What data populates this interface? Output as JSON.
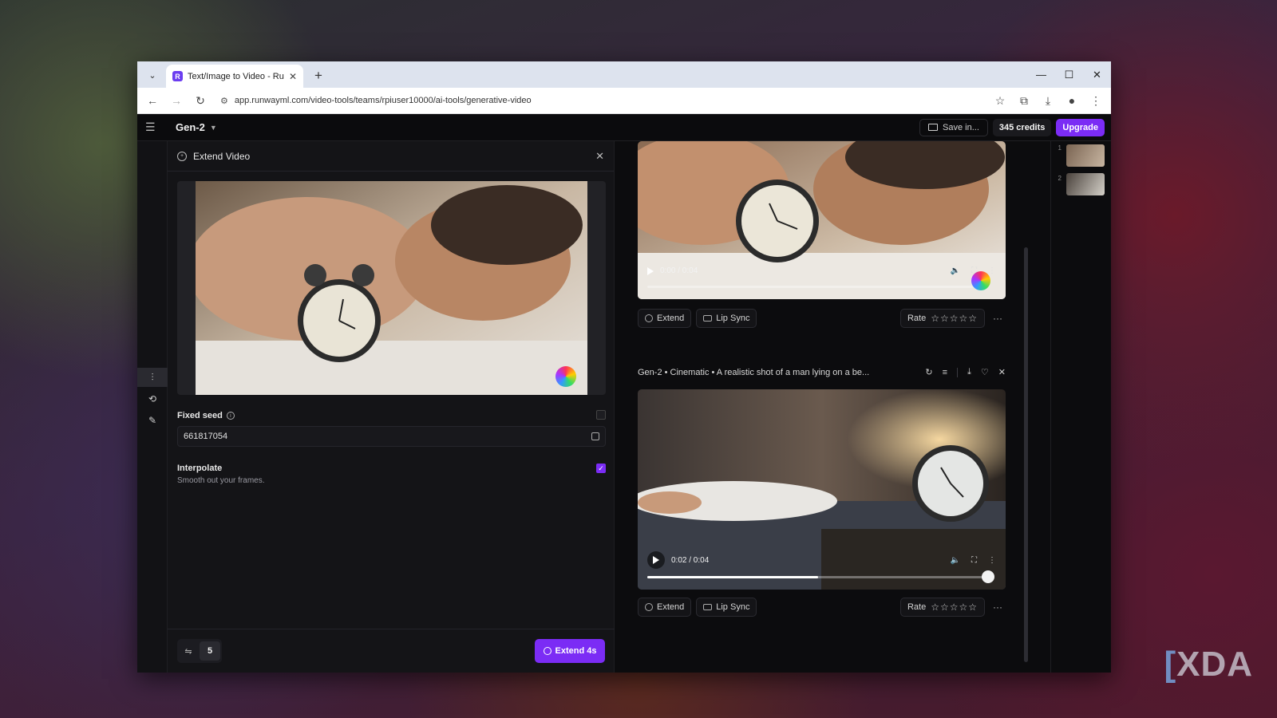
{
  "browser": {
    "tab_title": "Text/Image to Video - Runway",
    "tab_favicon": "R",
    "url": "app.runwayml.com/video-tools/teams/rpiuser10000/ai-tools/generative-video"
  },
  "header": {
    "model": "Gen-2",
    "save_label": "Save in...",
    "credits": "345 credits",
    "upgrade": "Upgrade"
  },
  "panel": {
    "title": "Extend Video",
    "fixed_seed_label": "Fixed seed",
    "seed_value": "661817054",
    "interpolate_label": "Interpolate",
    "interpolate_sub": "Smooth out your frames.",
    "interpolate_checked": true,
    "count": "5",
    "extend_button": "Extend 4s"
  },
  "feed": {
    "video1": {
      "time": "0:00 / 0:04",
      "progress": 0
    },
    "video2": {
      "title": "Gen-2 • Cinematic • A realistic shot of a man lying on a be...",
      "time": "0:02 / 0:04",
      "progress": 0.5
    },
    "actions": {
      "extend": "Extend",
      "lip_sync": "Lip Sync",
      "rate": "Rate",
      "stars": "☆☆☆☆☆",
      "more": "···"
    },
    "thumb_numbers": [
      "1",
      "2"
    ]
  },
  "watermark": {
    "brand": "XDA",
    "bracket": "["
  },
  "colors": {
    "accent": "#7b2cf5",
    "bg": "#0c0c0e",
    "panel": "#141417"
  }
}
